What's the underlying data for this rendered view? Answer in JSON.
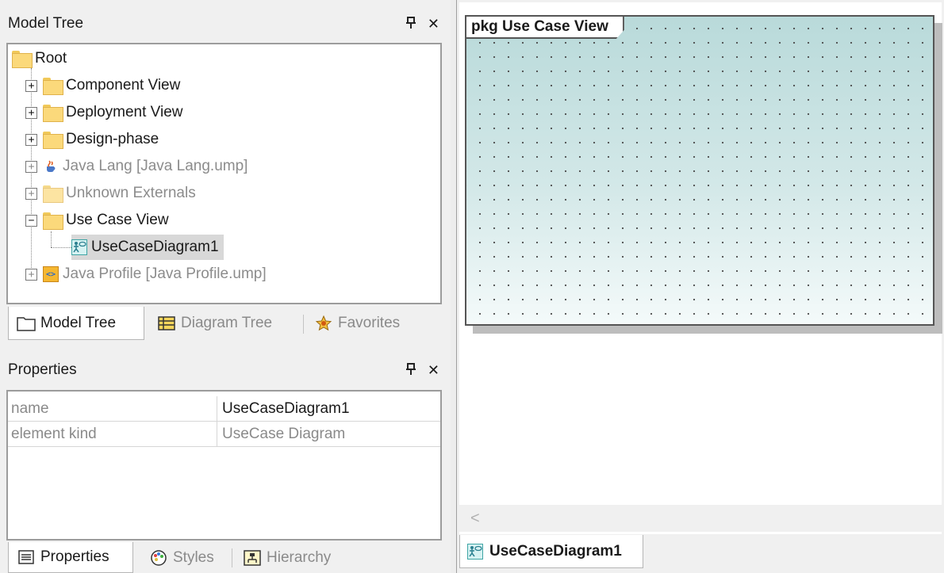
{
  "model_tree": {
    "title": "Model Tree",
    "pin_icon": "pin-icon",
    "close_icon": "close-icon",
    "root": "Root",
    "items": [
      {
        "label": "Component View",
        "icon": "folder-icon",
        "expander": "+",
        "greyed": false
      },
      {
        "label": "Deployment View",
        "icon": "folder-icon",
        "expander": "+",
        "greyed": false
      },
      {
        "label": "Design-phase",
        "icon": "folder-icon",
        "expander": "+",
        "greyed": false
      },
      {
        "label": "Java Lang [Java Lang.ump]",
        "icon": "java-cup-icon",
        "expander": "+",
        "greyed": true
      },
      {
        "label": "Unknown Externals",
        "icon": "folder-icon",
        "expander": "+",
        "greyed": true
      },
      {
        "label": "Use Case View",
        "icon": "folder-icon",
        "expander": "−",
        "greyed": false
      },
      {
        "label": "UseCaseDiagram1",
        "icon": "usecase-diagram-icon",
        "selected": true
      },
      {
        "label": "Java Profile [Java Profile.ump]",
        "icon": "profile-icon",
        "expander": "+",
        "greyed": true
      }
    ]
  },
  "top_tabs": [
    {
      "label": "Model Tree",
      "icon": "folder-outline-icon",
      "active": true
    },
    {
      "label": "Diagram Tree",
      "icon": "diagram-tree-icon",
      "active": false
    },
    {
      "label": "Favorites",
      "icon": "favorites-star-icon",
      "active": false
    }
  ],
  "properties": {
    "title": "Properties",
    "rows": [
      {
        "name": "name",
        "value": "UseCaseDiagram1",
        "editable": true
      },
      {
        "name": "element kind",
        "value": "UseCase Diagram",
        "editable": false
      }
    ]
  },
  "bottom_tabs": [
    {
      "label": "Properties",
      "icon": "properties-icon",
      "active": true
    },
    {
      "label": "Styles",
      "icon": "palette-icon",
      "active": false
    },
    {
      "label": "Hierarchy",
      "icon": "hierarchy-icon",
      "active": false
    }
  ],
  "diagram": {
    "package_label": "pkg Use Case View",
    "scroll_left": "<",
    "doc_tab": "UseCaseDiagram1"
  },
  "colors": {
    "folder": "#fbd97b",
    "selection": "#d8d8d8",
    "canvas_gradient_top": "#b9dada",
    "greyed_text": "#8c8c8c"
  }
}
